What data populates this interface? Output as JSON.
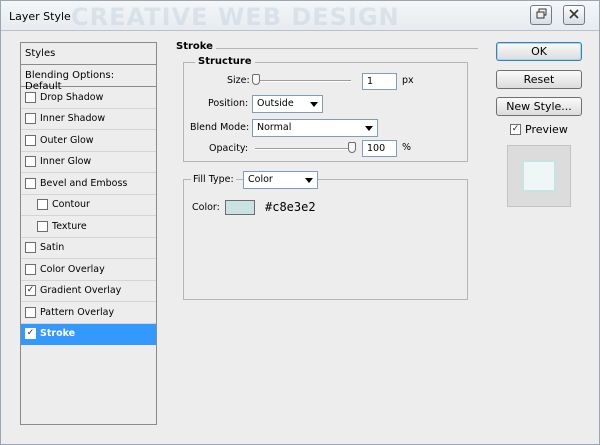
{
  "window": {
    "title": "Layer Style",
    "watermark": "CREATIVE WEB DESIGN"
  },
  "styles_panel": {
    "header": "Styles",
    "blending_options": "Blending Options: Default",
    "items": [
      {
        "label": "Drop Shadow",
        "checked": false,
        "sub": false,
        "selected": false
      },
      {
        "label": "Inner Shadow",
        "checked": false,
        "sub": false,
        "selected": false
      },
      {
        "label": "Outer Glow",
        "checked": false,
        "sub": false,
        "selected": false
      },
      {
        "label": "Inner Glow",
        "checked": false,
        "sub": false,
        "selected": false
      },
      {
        "label": "Bevel and Emboss",
        "checked": false,
        "sub": false,
        "selected": false
      },
      {
        "label": "Contour",
        "checked": false,
        "sub": true,
        "selected": false
      },
      {
        "label": "Texture",
        "checked": false,
        "sub": true,
        "selected": false
      },
      {
        "label": "Satin",
        "checked": false,
        "sub": false,
        "selected": false
      },
      {
        "label": "Color Overlay",
        "checked": false,
        "sub": false,
        "selected": false
      },
      {
        "label": "Gradient Overlay",
        "checked": true,
        "sub": false,
        "selected": false
      },
      {
        "label": "Pattern Overlay",
        "checked": false,
        "sub": false,
        "selected": false
      },
      {
        "label": "Stroke",
        "checked": true,
        "sub": false,
        "selected": true
      }
    ]
  },
  "stroke": {
    "title": "Stroke",
    "structure_title": "Structure",
    "size_label": "Size:",
    "size_value": "1",
    "size_unit": "px",
    "position_label": "Position:",
    "position_value": "Outside",
    "blend_mode_label": "Blend Mode:",
    "blend_mode_value": "Normal",
    "opacity_label": "Opacity:",
    "opacity_value": "100",
    "opacity_unit": "%",
    "fill_type_label": "Fill Type:",
    "fill_type_value": "Color",
    "color_label": "Color:",
    "color_hex": "#c8e3e2"
  },
  "buttons": {
    "ok": "OK",
    "reset": "Reset",
    "new_style": "New Style...",
    "preview_label": "Preview"
  },
  "colors": {
    "selection": "#3399ff",
    "stroke_color": "#c8e3e2"
  }
}
